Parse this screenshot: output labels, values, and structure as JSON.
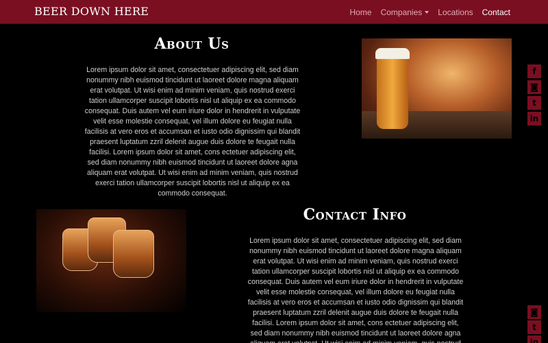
{
  "navbar": {
    "brand": "BEER DOWN HERE",
    "links": [
      {
        "label": "Home"
      },
      {
        "label": "Companies"
      },
      {
        "label": "Locations"
      },
      {
        "label": "Contact"
      }
    ],
    "active_color": "#ffffff",
    "background": "#7a0f22"
  },
  "about": {
    "title": "About Us",
    "text": "Lorem ipsum dolor sit amet, consectetuer adipiscing elit, sed diam nonummy nibh euismod tincidunt ut laoreet dolore magna aliquam erat volutpat. Ut wisi enim ad minim veniam, quis nostrud exerci tation ullamcorper suscipit lobortis nisl ut aliquip ex ea commodo consequat. Duis autem vel eum iriure dolor in hendrerit in vulputate velit esse molestie consequat, vel illum dolore eu feugiat nulla facilisis at vero eros et accumsan et iusto odio dignissim qui blandit praesent luptatum zzril delenit augue duis dolore te feugait nulla facilisi. Lorem ipsum dolor sit amet, cons ectetuer adipiscing elit, sed diam nonummy nibh euismod tincidunt ut laoreet dolore agna aliquam erat volutpat. Ut wisi enim ad minim veniam, quis nostrud exerci tation ullamcorper suscipit lobortis nisl ut aliquip ex ea commodo consequat."
  },
  "contact": {
    "title": "Contact Info",
    "text": "Lorem ipsum dolor sit amet, consectetuer adipiscing elit, sed diam nonummy nibh euismod tincidunt ut laoreet dolore magna aliquam erat volutpat. Ut wisi enim ad minim veniam, quis nostrud exerci tation ullamcorper suscipit lobortis nisl ut aliquip ex ea commodo consequat. Duis autem vel eum iriure dolor in hendrerit in vulputate velit esse molestie consequat, vel illum dolore eu feugiat nulla facilisis at vero eros et accumsan et iusto odio dignissim qui blandit praesent luptatum zzril delenit augue duis dolore te feugait nulla facilisi. Lorem ipsum dolor sit amet, cons ectetuer adipiscing elit, sed diam nonummy nibh euismod tincidunt ut laoreet dolore agna aliquam erat volutpat. Ut wisi enim ad minim veniam, quis nostrud exerci tation"
  },
  "social": {
    "icons": [
      "facebook-icon",
      "instagram-icon",
      "twitter-icon",
      "linkedin-icon"
    ],
    "glyphs": [
      "f",
      "◙",
      "t",
      "in"
    ],
    "color": "#7a0f22"
  }
}
